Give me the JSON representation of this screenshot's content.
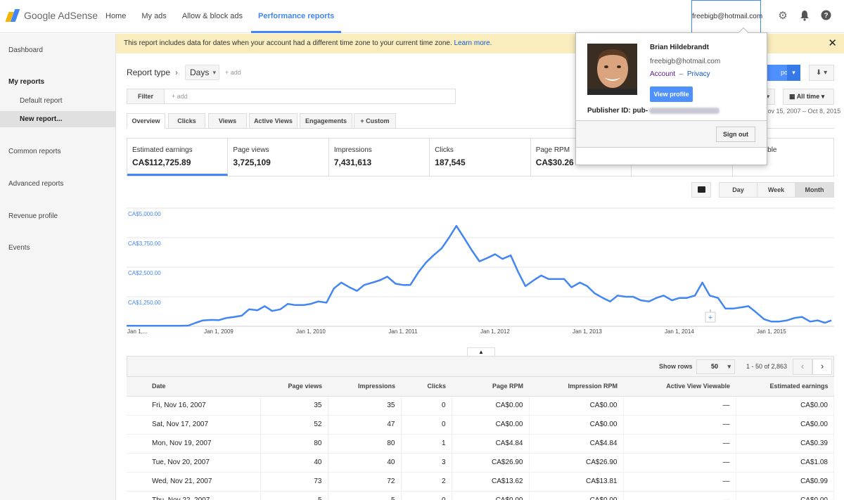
{
  "header": {
    "logo_text": "Google AdSense",
    "nav": [
      "Home",
      "My ads",
      "Allow & block ads",
      "Performance reports"
    ],
    "user_email": "freebigb@hotmail.com"
  },
  "sidebar": {
    "dashboard": "Dashboard",
    "my_reports": "My reports",
    "default_report": "Default report",
    "new_report": "New report...",
    "common_reports": "Common reports",
    "advanced_reports": "Advanced reports",
    "revenue_profile": "Revenue profile",
    "events": "Events"
  },
  "notice": {
    "text": "This report includes data for dates when your account had a different time zone to your current time zone.",
    "link": "Learn more."
  },
  "report": {
    "type_label": "Report type",
    "type_value": "Days",
    "add": "+ add",
    "filter_label": "Filter",
    "filter_placeholder": "+ add",
    "run_label": "ports",
    "date_label": "All time",
    "date_range": "Nov 15, 2007 – Oct 8, 2015"
  },
  "tabs": [
    "Overview",
    "Clicks",
    "Views",
    "Active Views",
    "Engagements",
    "+  Custom"
  ],
  "metrics": [
    {
      "label": "Estimated earnings",
      "value": "CA$112,725.89"
    },
    {
      "label": "Page views",
      "value": "3,725,109"
    },
    {
      "label": "Impressions",
      "value": "7,431,613"
    },
    {
      "label": "Clicks",
      "value": "187,545"
    },
    {
      "label": "Page RPM",
      "value": "CA$30.26"
    },
    {
      "label": "",
      "value": ""
    },
    {
      "label": "ew Viewable",
      "value": ""
    }
  ],
  "granularity": [
    "Day",
    "Week",
    "Month"
  ],
  "chart_data": {
    "type": "line",
    "y_ticks": [
      "CA$5,000.00",
      "CA$3,750.00",
      "CA$2,500.00",
      "CA$1,250.00"
    ],
    "y_tick_values": [
      5000,
      3750,
      2500,
      1250
    ],
    "x_ticks": [
      "Jan 1,...",
      "Jan 1, 2009",
      "Jan 1, 2010",
      "Jan 1, 2011",
      "Jan 1, 2012",
      "Jan 1, 2013",
      "Jan 1, 2014",
      "Jan 1, 2015"
    ],
    "x_tick_dates": [
      2008.0,
      2009.0,
      2010.0,
      2011.0,
      2012.0,
      2013.0,
      2014.0,
      2015.0
    ],
    "xlim": [
      2008.0,
      2015.65
    ],
    "ylim": [
      0,
      5000
    ],
    "color": "#4285f4",
    "series": [
      {
        "x": [
          2008.0,
          2008.08,
          2008.17,
          2008.25,
          2008.33,
          2008.42,
          2008.5,
          2008.58,
          2008.67,
          2008.75,
          2008.83,
          2008.92,
          2009.0,
          2009.08,
          2009.17,
          2009.25,
          2009.33,
          2009.42,
          2009.5,
          2009.58,
          2009.67,
          2009.75,
          2009.83,
          2009.92,
          2010.0,
          2010.08,
          2010.17,
          2010.25,
          2010.33,
          2010.42,
          2010.5,
          2010.58,
          2010.67,
          2010.75,
          2010.83,
          2010.92,
          2011.0,
          2011.08,
          2011.17,
          2011.25,
          2011.33,
          2011.42,
          2011.5,
          2011.58,
          2011.67,
          2011.75,
          2011.83,
          2011.92,
          2012.0,
          2012.08,
          2012.17,
          2012.25,
          2012.33,
          2012.42,
          2012.5,
          2012.58,
          2012.67,
          2012.75,
          2012.83,
          2012.92,
          2013.0,
          2013.08,
          2013.17,
          2013.25,
          2013.33,
          2013.42,
          2013.5,
          2013.58,
          2013.67,
          2013.75,
          2013.83,
          2013.92,
          2014.0,
          2014.08,
          2014.17,
          2014.25,
          2014.33,
          2014.42,
          2014.5,
          2014.58,
          2014.67,
          2014.75,
          2014.83,
          2014.92,
          2015.0,
          2015.08,
          2015.17,
          2015.25,
          2015.33,
          2015.42,
          2015.5,
          2015.58,
          2015.65
        ],
        "y": [
          20,
          20,
          20,
          20,
          20,
          20,
          20,
          20,
          30,
          150,
          250,
          270,
          260,
          350,
          400,
          450,
          720,
          680,
          850,
          650,
          720,
          950,
          900,
          900,
          950,
          1050,
          1000,
          1600,
          1850,
          1650,
          1500,
          1750,
          1850,
          1950,
          2100,
          1800,
          1750,
          1750,
          2300,
          2700,
          3000,
          3300,
          3750,
          4250,
          3700,
          3200,
          2750,
          2900,
          3050,
          2850,
          3000,
          2300,
          1700,
          1950,
          2150,
          2000,
          2000,
          2000,
          1650,
          1850,
          1700,
          1400,
          1200,
          1050,
          1300,
          1250,
          1250,
          1100,
          1050,
          1200,
          1300,
          1100,
          1200,
          1200,
          1300,
          1850,
          1300,
          1200,
          750,
          750,
          800,
          850,
          600,
          300,
          200,
          200,
          250,
          350,
          400,
          200,
          250,
          150,
          250
        ]
      }
    ]
  },
  "table": {
    "show_rows_label": "Show rows",
    "rows_value": "50",
    "pager_text": "1 - 50 of 2,863",
    "columns": [
      "Date",
      "Page views",
      "Impressions",
      "Clicks",
      "Page RPM",
      "Impression RPM",
      "Active View Viewable",
      "Estimated earnings"
    ],
    "rows": [
      [
        "Fri, Nov 16, 2007",
        "35",
        "35",
        "0",
        "CA$0.00",
        "CA$0.00",
        "—",
        "CA$0.00"
      ],
      [
        "Sat, Nov 17, 2007",
        "52",
        "47",
        "0",
        "CA$0.00",
        "CA$0.00",
        "—",
        "CA$0.00"
      ],
      [
        "Mon, Nov 19, 2007",
        "80",
        "80",
        "1",
        "CA$4.84",
        "CA$4.84",
        "—",
        "CA$0.39"
      ],
      [
        "Tue, Nov 20, 2007",
        "40",
        "40",
        "3",
        "CA$26.90",
        "CA$26.90",
        "—",
        "CA$1.08"
      ],
      [
        "Wed, Nov 21, 2007",
        "73",
        "72",
        "2",
        "CA$13.62",
        "CA$13.81",
        "—",
        "CA$0.99"
      ],
      [
        "Thu, Nov 22, 2007",
        "5",
        "5",
        "0",
        "CA$0.00",
        "CA$0.00",
        "—",
        "CA$0.00"
      ]
    ]
  },
  "popup": {
    "name": "Brian Hildebrandt",
    "email": "freebigb@hotmail.com",
    "account": "Account",
    "dash": "–",
    "privacy": "Privacy",
    "view_profile": "View profile",
    "publisher_label": "Publisher ID: pub-",
    "sign_out": "Sign out"
  }
}
